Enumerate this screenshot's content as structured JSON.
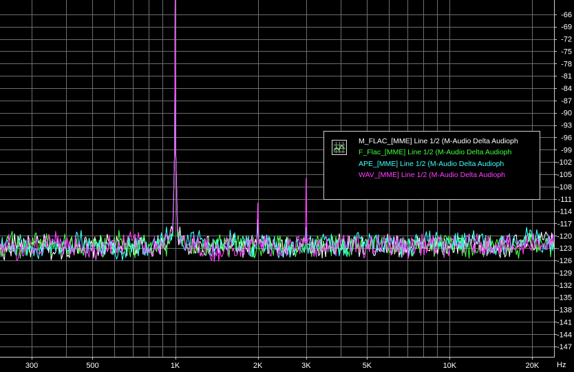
{
  "chart_data": {
    "type": "line",
    "title": "",
    "xlabel": "",
    "ylabel": "",
    "x_unit": "Hz",
    "x_scale": "log",
    "xlim": [
      230,
      24000
    ],
    "ylim": [
      -149.5,
      -62.5
    ],
    "grid": true,
    "legend_placement": "center-right",
    "background_color": "#000000",
    "grid_color": "#6e6e6e",
    "x_ticks": [
      {
        "value": 300,
        "label": "300"
      },
      {
        "value": 500,
        "label": "500"
      },
      {
        "value": 1000,
        "label": "1K"
      },
      {
        "value": 2000,
        "label": "2K"
      },
      {
        "value": 3000,
        "label": "3K"
      },
      {
        "value": 5000,
        "label": "5K"
      },
      {
        "value": 10000,
        "label": "10K"
      },
      {
        "value": 20000,
        "label": "20K"
      }
    ],
    "x_minor_grid": [
      400,
      600,
      700,
      800,
      900,
      4000,
      6000,
      7000,
      8000,
      9000
    ],
    "y_ticks": [
      {
        "value": -66,
        "label": "-66"
      },
      {
        "value": -69,
        "label": "-69"
      },
      {
        "value": -72,
        "label": "-72"
      },
      {
        "value": -75,
        "label": "-75"
      },
      {
        "value": -78,
        "label": "-78"
      },
      {
        "value": -81,
        "label": "-81"
      },
      {
        "value": -84,
        "label": "-84"
      },
      {
        "value": -87,
        "label": "-87"
      },
      {
        "value": -90,
        "label": "-90"
      },
      {
        "value": -93,
        "label": "-93"
      },
      {
        "value": -96,
        "label": "-96"
      },
      {
        "value": -99,
        "label": "-99"
      },
      {
        "value": -102,
        "label": "-102"
      },
      {
        "value": -105,
        "label": "-105"
      },
      {
        "value": -108,
        "label": "-108"
      },
      {
        "value": -111,
        "label": "-111"
      },
      {
        "value": -114,
        "label": "-114"
      },
      {
        "value": -117,
        "label": "-117"
      },
      {
        "value": -120,
        "label": "-120"
      },
      {
        "value": -123,
        "label": "-123"
      },
      {
        "value": -126,
        "label": "-126"
      },
      {
        "value": -129,
        "label": "-129"
      },
      {
        "value": -132,
        "label": "-132"
      },
      {
        "value": -135,
        "label": "-135"
      },
      {
        "value": -138,
        "label": "-138"
      },
      {
        "value": -141,
        "label": "-141"
      },
      {
        "value": -144,
        "label": "-144"
      },
      {
        "value": -147,
        "label": "-147"
      }
    ],
    "series": [
      {
        "name": "M_FLAC_[MME] Line 1/2 (M-Audio Delta Audioph",
        "color": "#ffffff",
        "points": [
          [
            230,
            -124
          ],
          [
            250,
            -123
          ],
          [
            270,
            -121
          ],
          [
            300,
            -123
          ],
          [
            330,
            -122
          ],
          [
            360,
            -124
          ],
          [
            400,
            -123
          ],
          [
            450,
            -122
          ],
          [
            500,
            -123
          ],
          [
            560,
            -122
          ],
          [
            630,
            -123
          ],
          [
            700,
            -122
          ],
          [
            800,
            -123
          ],
          [
            900,
            -122
          ],
          [
            950,
            -121
          ],
          [
            980,
            -119
          ],
          [
            995,
            -100
          ],
          [
            1000,
            -60
          ],
          [
            1005,
            -100
          ],
          [
            1020,
            -119
          ],
          [
            1050,
            -121
          ],
          [
            1100,
            -123
          ],
          [
            1200,
            -122
          ],
          [
            1400,
            -123
          ],
          [
            1600,
            -122
          ],
          [
            1800,
            -123
          ],
          [
            1980,
            -122
          ],
          [
            2000,
            -116
          ],
          [
            2020,
            -122
          ],
          [
            2500,
            -123
          ],
          [
            2980,
            -122
          ],
          [
            3000,
            -118
          ],
          [
            3020,
            -122
          ],
          [
            3500,
            -123
          ],
          [
            4000,
            -122
          ],
          [
            5000,
            -123
          ],
          [
            6000,
            -122
          ],
          [
            7000,
            -123
          ],
          [
            8000,
            -122
          ],
          [
            10000,
            -123
          ],
          [
            12000,
            -122
          ],
          [
            15000,
            -123
          ],
          [
            18000,
            -122
          ],
          [
            20000,
            -122
          ],
          [
            22000,
            -121
          ],
          [
            24000,
            -122
          ]
        ]
      },
      {
        "name": "F_Flac_[MME] Line 1/2 (M-Audio Delta Audioph",
        "color": "#40ff40",
        "points": [
          [
            230,
            -123
          ],
          [
            250,
            -121
          ],
          [
            270,
            -123
          ],
          [
            300,
            -122
          ],
          [
            330,
            -121
          ],
          [
            360,
            -123
          ],
          [
            400,
            -122
          ],
          [
            450,
            -123
          ],
          [
            500,
            -122
          ],
          [
            560,
            -123
          ],
          [
            630,
            -121
          ],
          [
            700,
            -123
          ],
          [
            800,
            -122
          ],
          [
            900,
            -123
          ],
          [
            950,
            -122
          ],
          [
            980,
            -120
          ],
          [
            995,
            -100
          ],
          [
            1000,
            -60
          ],
          [
            1005,
            -100
          ],
          [
            1020,
            -120
          ],
          [
            1050,
            -121
          ],
          [
            1100,
            -122
          ],
          [
            1200,
            -123
          ],
          [
            1400,
            -122
          ],
          [
            1600,
            -123
          ],
          [
            1800,
            -122
          ],
          [
            1980,
            -123
          ],
          [
            2000,
            -117
          ],
          [
            2020,
            -123
          ],
          [
            2500,
            -122
          ],
          [
            2980,
            -123
          ],
          [
            3000,
            -119
          ],
          [
            3020,
            -123
          ],
          [
            3500,
            -122
          ],
          [
            4000,
            -123
          ],
          [
            5000,
            -122
          ],
          [
            6000,
            -123
          ],
          [
            7000,
            -122
          ],
          [
            8000,
            -123
          ],
          [
            10000,
            -122
          ],
          [
            12000,
            -123
          ],
          [
            15000,
            -122
          ],
          [
            18000,
            -123
          ],
          [
            20000,
            -121
          ],
          [
            22000,
            -122
          ],
          [
            24000,
            -123
          ]
        ]
      },
      {
        "name": "APE_[MME] Line 1/2 (M-Audio Delta Audioph",
        "color": "#40ffff",
        "points": [
          [
            230,
            -122
          ],
          [
            250,
            -124
          ],
          [
            270,
            -122
          ],
          [
            300,
            -123
          ],
          [
            330,
            -124
          ],
          [
            360,
            -122
          ],
          [
            400,
            -123
          ],
          [
            450,
            -121
          ],
          [
            500,
            -123
          ],
          [
            560,
            -122
          ],
          [
            630,
            -124
          ],
          [
            700,
            -122
          ],
          [
            800,
            -123
          ],
          [
            900,
            -121
          ],
          [
            950,
            -120
          ],
          [
            980,
            -118
          ],
          [
            995,
            -100
          ],
          [
            1000,
            -60
          ],
          [
            1005,
            -100
          ],
          [
            1020,
            -118
          ],
          [
            1050,
            -120
          ],
          [
            1100,
            -122
          ],
          [
            1200,
            -121
          ],
          [
            1400,
            -123
          ],
          [
            1600,
            -121
          ],
          [
            1800,
            -122
          ],
          [
            1980,
            -123
          ],
          [
            2000,
            -117
          ],
          [
            2020,
            -122
          ],
          [
            2500,
            -123
          ],
          [
            2980,
            -122
          ],
          [
            3000,
            -118
          ],
          [
            3020,
            -122
          ],
          [
            3500,
            -121
          ],
          [
            4000,
            -123
          ],
          [
            5000,
            -121
          ],
          [
            6000,
            -122
          ],
          [
            7000,
            -123
          ],
          [
            8000,
            -121
          ],
          [
            10000,
            -122
          ],
          [
            12000,
            -121
          ],
          [
            15000,
            -123
          ],
          [
            18000,
            -121
          ],
          [
            20000,
            -120
          ],
          [
            22000,
            -122
          ],
          [
            24000,
            -121
          ]
        ]
      },
      {
        "name": "WAV_[MME] Line 1/2 (M-Audio Delta Audioph",
        "color": "#ff40ff",
        "points": [
          [
            230,
            -123
          ],
          [
            250,
            -122
          ],
          [
            270,
            -124
          ],
          [
            300,
            -122
          ],
          [
            330,
            -123
          ],
          [
            360,
            -121
          ],
          [
            400,
            -123
          ],
          [
            450,
            -122
          ],
          [
            500,
            -124
          ],
          [
            560,
            -122
          ],
          [
            630,
            -123
          ],
          [
            700,
            -121
          ],
          [
            800,
            -123
          ],
          [
            900,
            -122
          ],
          [
            950,
            -121
          ],
          [
            980,
            -119
          ],
          [
            995,
            -100
          ],
          [
            1000,
            -60
          ],
          [
            1005,
            -100
          ],
          [
            1020,
            -119
          ],
          [
            1050,
            -121
          ],
          [
            1100,
            -123
          ],
          [
            1200,
            -122
          ],
          [
            1400,
            -124
          ],
          [
            1600,
            -122
          ],
          [
            1800,
            -123
          ],
          [
            1980,
            -122
          ],
          [
            2000,
            -112
          ],
          [
            2020,
            -122
          ],
          [
            2500,
            -123
          ],
          [
            2980,
            -122
          ],
          [
            3000,
            -106
          ],
          [
            3020,
            -122
          ],
          [
            3500,
            -123
          ],
          [
            4000,
            -122
          ],
          [
            5000,
            -123
          ],
          [
            6000,
            -122
          ],
          [
            7000,
            -123
          ],
          [
            8000,
            -122
          ],
          [
            10000,
            -123
          ],
          [
            12000,
            -122
          ],
          [
            15000,
            -122
          ],
          [
            18000,
            -123
          ],
          [
            20000,
            -121
          ],
          [
            22000,
            -122
          ],
          [
            24000,
            -122
          ]
        ]
      }
    ]
  }
}
